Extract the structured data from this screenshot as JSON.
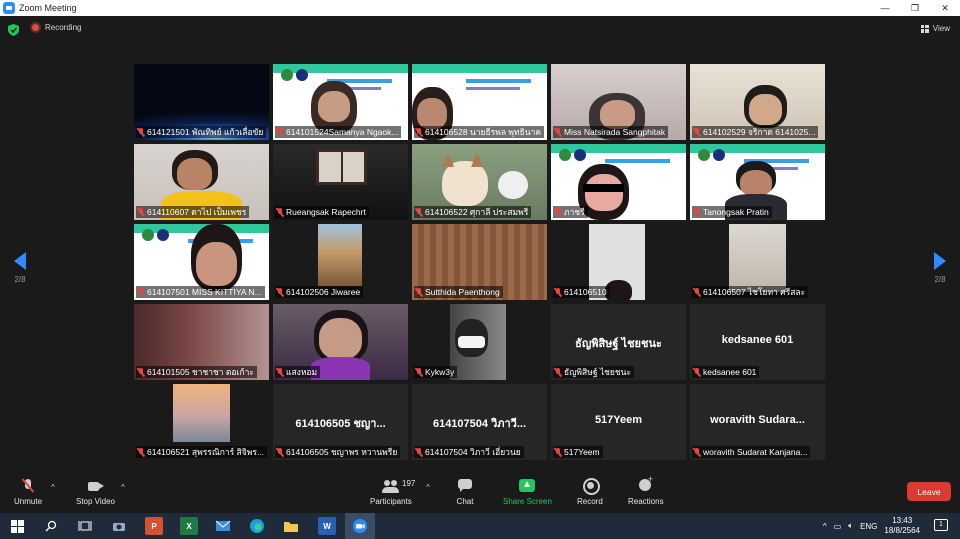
{
  "window": {
    "title": "Zoom Meeting",
    "controls": [
      "—",
      "❐",
      "✕"
    ]
  },
  "topbar": {
    "recording_label": "Recording",
    "view_label": "View"
  },
  "pagination": {
    "left": "2/8",
    "right": "2/8"
  },
  "participants": [
    {
      "name": "614121501 พัณทิพย์ แก้วเลื่อขัย",
      "scene": "earth"
    },
    {
      "name": "614101524Samanya Ngaok...",
      "scene": "slide-face"
    },
    {
      "name": "614106528 นายธีรพล พุทธินาค",
      "scene": "slide-face2"
    },
    {
      "name": "Miss Natsirada Sangphitak",
      "scene": "wall-pink"
    },
    {
      "name": "614102529 จริกาด 6141025...",
      "scene": "wall-cream"
    },
    {
      "name": "614110607 ดาไป เป็มเพชร",
      "scene": "yellow-person"
    },
    {
      "name": "Rueangsak Rapechrt",
      "scene": "dark-window"
    },
    {
      "name": "614106522 ศุกาลี ประสมพรี",
      "scene": "dog-filter"
    },
    {
      "name": "ภาชรี",
      "scene": "slide-glasses"
    },
    {
      "name": "Tanongsak Pratin",
      "scene": "slide-man"
    },
    {
      "name": "614107501 MISS KITTIYA N...",
      "scene": "slide-face3"
    },
    {
      "name": "614102506 Jiwaree",
      "scene": "building"
    },
    {
      "name": "Sutthida Paenthong",
      "scene": "wood"
    },
    {
      "name": "614106510",
      "scene": "white-wall"
    },
    {
      "name": "614106507 ไชโยทา ศรีสละ",
      "scene": "door"
    },
    {
      "name": "614101505 ชาชาชา ตอเก้าะ",
      "scene": "curtain"
    },
    {
      "name": "แสงหอม",
      "scene": "purple-glasses"
    },
    {
      "name": "Kykw3y",
      "scene": "mask"
    },
    {
      "name": "ธัญพิสิษฐ์ ไชยชนะ",
      "display": "ธัญพิสิษฐ์ ไชยชนะ",
      "scene": "none"
    },
    {
      "name": "kedsanee 601",
      "display": "kedsanee 601",
      "scene": "none"
    },
    {
      "name": "614106521 สุพรรณิการ์ สิจิพร...",
      "scene": "sunset"
    },
    {
      "name": "614106505 ชญาพร หวานพรีย",
      "display": "614106505 ชญา...",
      "scene": "none"
    },
    {
      "name": "614107504 วิภาวี เอี่ยวนย",
      "display": "614107504 วิภาวี...",
      "scene": "none"
    },
    {
      "name": "517Yeem",
      "display": "517Yeem",
      "scene": "none"
    },
    {
      "name": "woravith Sudarat Kanjana...",
      "display": "woravith  Sudara...",
      "scene": "none"
    }
  ],
  "toolbar": {
    "unmute": "Unmute",
    "stop_video": "Stop Video",
    "participants": "Participants",
    "participant_count": "197",
    "chat": "Chat",
    "share_screen": "Share Screen",
    "record": "Record",
    "reactions": "Reactions",
    "leave": "Leave"
  },
  "taskbar": {
    "apps": [
      "Start",
      "Search",
      "Task View",
      "Camera",
      "PowerPoint",
      "Excel",
      "Mail",
      "Edge",
      "File Explorer",
      "Word",
      "Zoom"
    ],
    "app_letters": {
      "powerpoint": "P",
      "excel": "X",
      "word": "W"
    },
    "language": "ENG",
    "time": "13:43",
    "date": "18/8/2564",
    "notifications": "1"
  },
  "colors": {
    "accent": "#2d8cff",
    "share": "#22c55e",
    "leave": "#d93a32",
    "mute": "#e8453c"
  }
}
